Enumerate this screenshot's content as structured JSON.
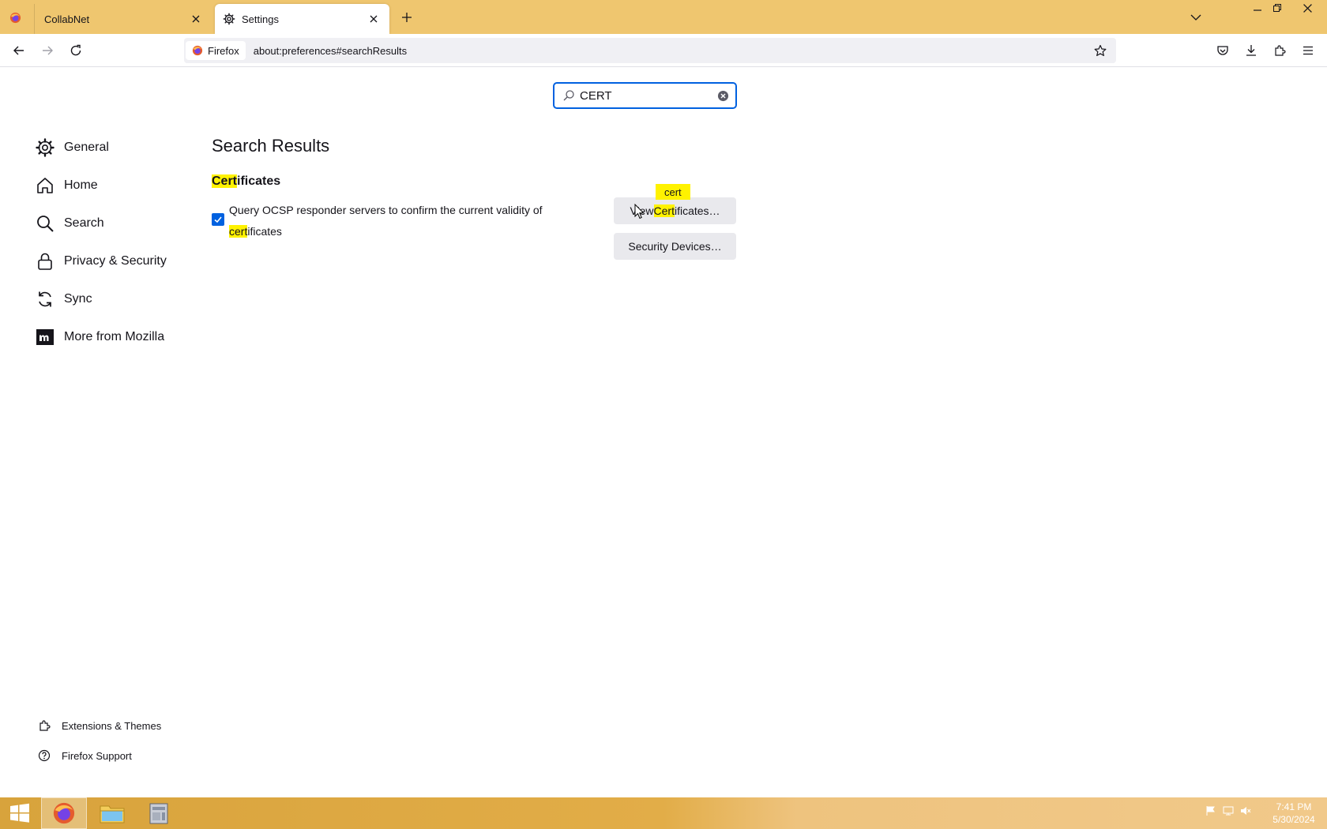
{
  "browser": {
    "tabs": [
      {
        "title": "CollabNet",
        "active": false
      },
      {
        "title": "Settings",
        "active": true
      }
    ],
    "identity_label": "Firefox",
    "url": "about:preferences#searchResults"
  },
  "preferences": {
    "search_value": "CERT",
    "categories": [
      {
        "label": "General",
        "icon": "gear-icon"
      },
      {
        "label": "Home",
        "icon": "home-icon"
      },
      {
        "label": "Search",
        "icon": "search-icon"
      },
      {
        "label": "Privacy & Security",
        "icon": "lock-icon"
      },
      {
        "label": "Sync",
        "icon": "sync-icon"
      },
      {
        "label": "More from Mozilla",
        "icon": "mozilla-icon"
      }
    ],
    "footer": [
      {
        "label": "Extensions & Themes",
        "icon": "puzzle-icon"
      },
      {
        "label": "Firefox Support",
        "icon": "help-icon"
      }
    ],
    "results_title": "Search Results",
    "section": {
      "heading_match": "Cert",
      "heading_rest": "ificates",
      "ocsp_text_before": "Query OCSP responder servers to confirm the current validity of ",
      "ocsp_match": "cert",
      "ocsp_text_after": "ificates",
      "ocsp_checked": true,
      "view_btn_before": "View ",
      "view_btn_match": "Cert",
      "view_btn_after": "ificates…",
      "security_devices_label": "Security Devices…",
      "tooltip": "cert"
    }
  },
  "taskbar": {
    "time": "7:41 PM",
    "date": "5/30/2024"
  },
  "colors": {
    "tabbar": "#efc66f",
    "accent": "#0061e0",
    "highlight": "#fff200"
  }
}
